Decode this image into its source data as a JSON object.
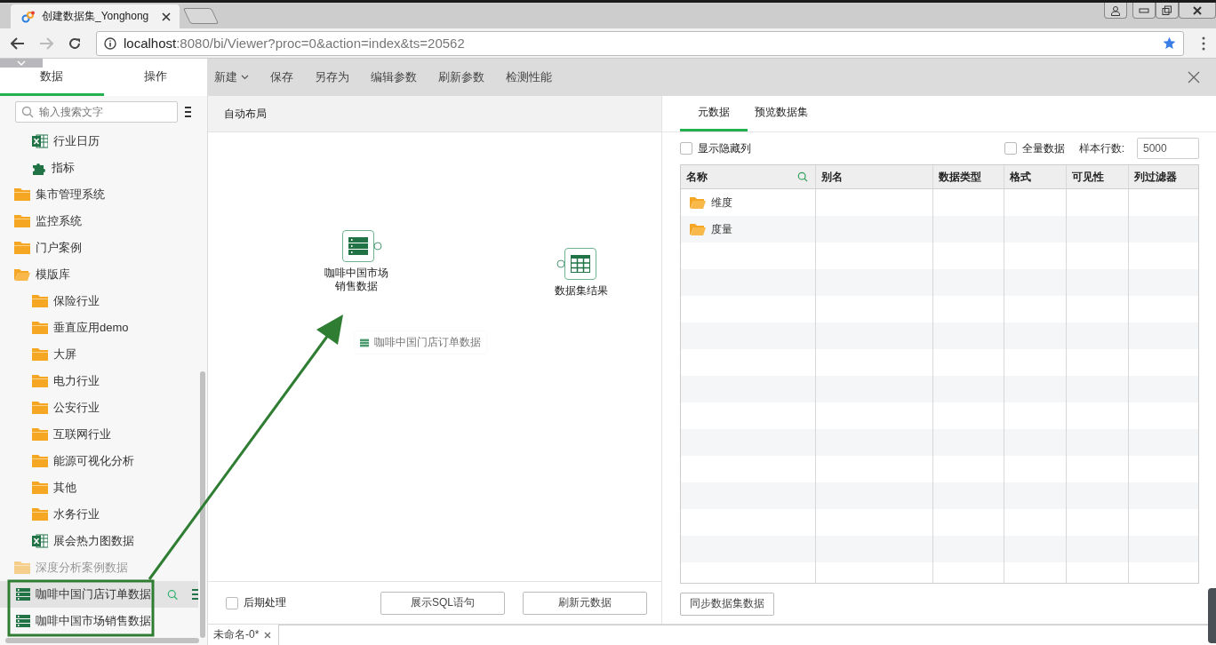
{
  "browser": {
    "tab_title": "创建数据集_Yonghong",
    "url_host": "localhost",
    "url_rest": ":8080/bi/Viewer?proc=0&action=index&ts=20562"
  },
  "sidebar": {
    "tabs": [
      {
        "label": "数据",
        "selected": true
      },
      {
        "label": "操作",
        "selected": false
      }
    ],
    "search": {
      "placeholder": "输入搜索文字"
    },
    "tree": [
      {
        "children": [
          {
            "label": "行业日历",
            "kind": "excel"
          },
          {
            "label": "指标",
            "kind": "puzzle"
          }
        ]
      },
      {
        "label": "集市管理系统",
        "kind": "folder",
        "expanded": false,
        "disabled": false
      },
      {
        "label": "监控系统",
        "kind": "folder",
        "expanded": false,
        "disabled": false
      },
      {
        "label": "门户案例",
        "kind": "folder",
        "expanded": false,
        "disabled": false
      },
      {
        "label": "模版库",
        "kind": "folder",
        "expanded": true,
        "disabled": false,
        "children": [
          {
            "label": "保险行业",
            "kind": "folder",
            "expanded": false
          },
          {
            "label": "垂直应用demo",
            "kind": "folder",
            "expanded": false
          },
          {
            "label": "大屏",
            "kind": "folder",
            "expanded": false
          },
          {
            "label": "电力行业",
            "kind": "folder",
            "expanded": false
          },
          {
            "label": "公安行业",
            "kind": "folder",
            "expanded": false
          },
          {
            "label": "互联网行业",
            "kind": "folder",
            "expanded": false
          },
          {
            "label": "能源可视化分析",
            "kind": "folder",
            "expanded": false
          },
          {
            "label": "其他",
            "kind": "folder",
            "expanded": false
          },
          {
            "label": "水务行业",
            "kind": "folder",
            "expanded": false
          },
          {
            "label": "展会热力图数据",
            "kind": "excel"
          }
        ]
      },
      {
        "label": "深度分析案例数据",
        "kind": "folder",
        "expanded": false,
        "disabled": true
      }
    ],
    "datasets": [
      {
        "label": "咖啡中国门店订单数据",
        "selected": true
      },
      {
        "label": "咖啡中国市场销售数据",
        "selected": false
      }
    ]
  },
  "toolbar": [
    {
      "label": "新建",
      "dropdown": true
    },
    {
      "label": "保存",
      "dropdown": false
    },
    {
      "label": "另存为",
      "dropdown": false
    },
    {
      "label": "编辑参数",
      "dropdown": false
    },
    {
      "label": "刷新参数",
      "dropdown": false
    },
    {
      "label": "检测性能",
      "dropdown": false
    }
  ],
  "canvas": {
    "header": "自动布局",
    "nodes": [
      {
        "kind": "source",
        "label": "咖啡中国市场销售数据"
      },
      {
        "kind": "result",
        "label": "数据集结果"
      }
    ],
    "drag_ghost": "咖啡中国门店订单数据",
    "post_process": {
      "label": "后期处理",
      "checked": false
    },
    "buttons": [
      "展示SQL语句",
      "刷新元数据"
    ]
  },
  "meta": {
    "tabs": [
      {
        "label": "元数据",
        "selected": true
      },
      {
        "label": "预览数据集",
        "selected": false
      }
    ],
    "show_hidden": {
      "label": "显示隐藏列",
      "checked": false
    },
    "full_data": {
      "label": "全量数据",
      "checked": false
    },
    "sample_label": "样本行数:",
    "sample_value": "5000",
    "columns": [
      "名称",
      "别名",
      "数据类型",
      "格式",
      "可见性",
      "列过滤器"
    ],
    "rows": [
      {
        "name": "维度"
      },
      {
        "name": "度量"
      }
    ],
    "sync_button": "同步数据集数据"
  },
  "doc_tabs": [
    {
      "label": "未命名-0*"
    }
  ]
}
